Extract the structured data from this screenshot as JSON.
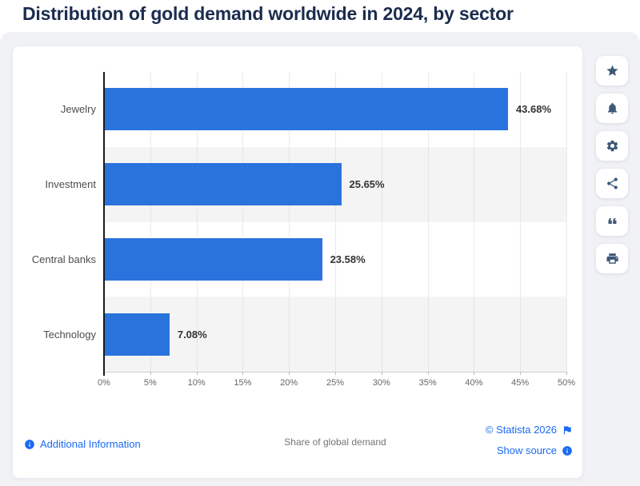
{
  "page": {
    "title": "Distribution of gold demand worldwide in 2024, by sector"
  },
  "chart_data": {
    "type": "bar",
    "orientation": "horizontal",
    "title": "Distribution of gold demand worldwide in 2024, by sector",
    "categories": [
      "Jewelry",
      "Investment",
      "Central banks",
      "Technology"
    ],
    "values": [
      43.68,
      25.65,
      23.58,
      7.08
    ],
    "value_labels": [
      "43.68%",
      "25.65%",
      "23.58%",
      "7.08%"
    ],
    "xlabel": "Share of global demand",
    "ylabel": "",
    "xlim": [
      0,
      50
    ],
    "x_ticks": [
      0,
      5,
      10,
      15,
      20,
      25,
      30,
      35,
      40,
      45,
      50
    ],
    "x_tick_labels": [
      "0%",
      "5%",
      "10%",
      "15%",
      "20%",
      "25%",
      "30%",
      "35%",
      "40%",
      "45%",
      "50%"
    ],
    "grid": true,
    "legend": false,
    "bar_color": "#2a73dc",
    "row_alt_color": "#f4f4f4"
  },
  "sidebar": {
    "buttons": [
      {
        "name": "favorite-button",
        "icon": "star-icon"
      },
      {
        "name": "alerts-button",
        "icon": "bell-icon"
      },
      {
        "name": "settings-button",
        "icon": "gear-icon"
      },
      {
        "name": "share-button",
        "icon": "share-icon"
      },
      {
        "name": "cite-button",
        "icon": "quote-icon"
      },
      {
        "name": "print-button",
        "icon": "print-icon"
      }
    ]
  },
  "footer": {
    "additional_info_label": "Additional Information",
    "copyright_label": "© Statista 2026",
    "show_source_label": "Show source"
  },
  "colors": {
    "accent_blue": "#2a73dc",
    "link_blue": "#1a6af5",
    "icon_navy": "#3d5878",
    "title_navy": "#1b2c4e",
    "row_alt": "#f4f4f4"
  }
}
